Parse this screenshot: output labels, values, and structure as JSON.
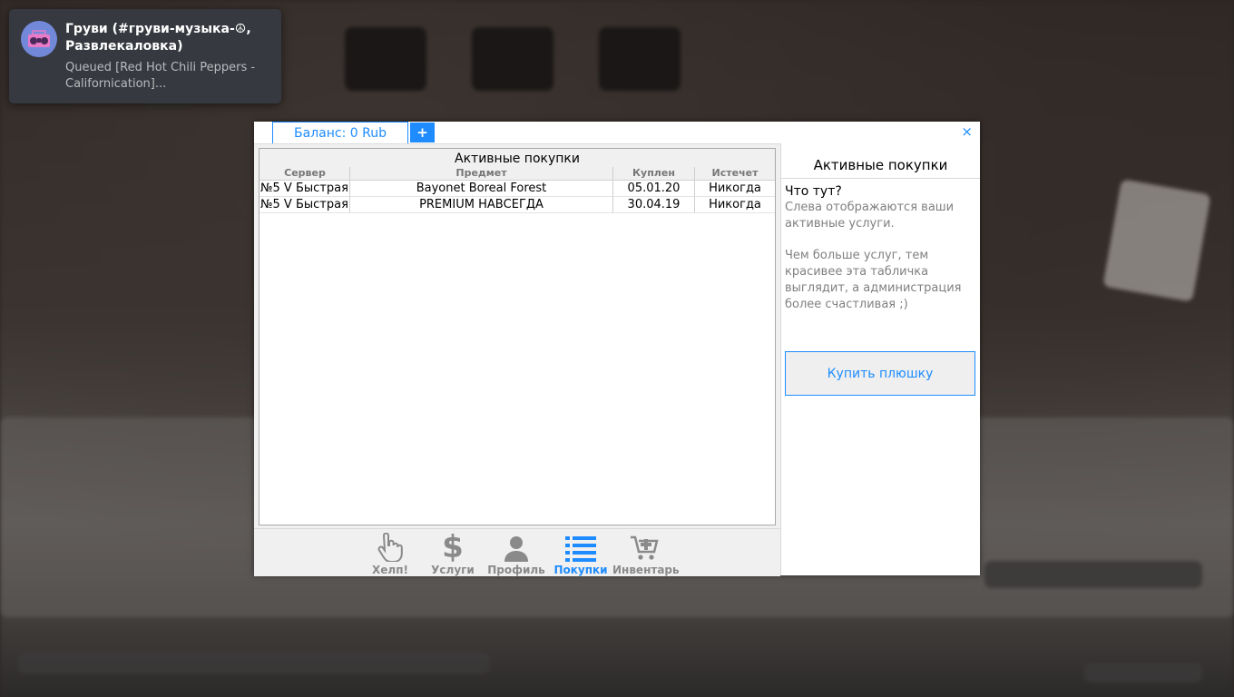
{
  "toast": {
    "title": "Груви (#груви-музыка-☮, Развлекаловка)",
    "message": "Queued [Red Hot Chili Peppers - Californication]...",
    "avatar_icon": "boombox-icon",
    "avatar_color": "#7289da"
  },
  "window": {
    "balance_tab": "Баланс: 0 Rub",
    "add_funds_label": "+",
    "close_label": "×",
    "accent_color": "#1e8cff"
  },
  "purchases_table": {
    "caption": "Активные покупки",
    "columns": [
      "Сервер",
      "Предмет",
      "Куплен",
      "Истечет"
    ],
    "rows": [
      {
        "server": "№5 V Быстрая",
        "item": "Bayonet Boreal Forest",
        "bought": "05.01.20",
        "expires": "Никогда"
      },
      {
        "server": "№5 V Быстрая",
        "item": "PREMIUM НАВСЕГДА",
        "bought": "30.04.19",
        "expires": "Никогда"
      }
    ]
  },
  "nav": {
    "items": [
      {
        "label": "Хелп!",
        "icon": "pointing-hand-icon",
        "active": false
      },
      {
        "label": "Услуги",
        "icon": "dollar-icon",
        "active": false
      },
      {
        "label": "Профиль",
        "icon": "user-icon",
        "active": false
      },
      {
        "label": "Покупки",
        "icon": "list-icon",
        "active": true
      },
      {
        "label": "Инвентарь",
        "icon": "cart-add-icon",
        "active": false
      }
    ]
  },
  "info_panel": {
    "title": "Активные покупки",
    "question": "Что тут?",
    "paragraph1": "Слева отображаются ваши активные услуги.",
    "paragraph2": "Чем больше услуг, тем красивее эта табличка выглядит, а администрация более счастливая ;)",
    "buy_button": "Купить плюшку"
  }
}
